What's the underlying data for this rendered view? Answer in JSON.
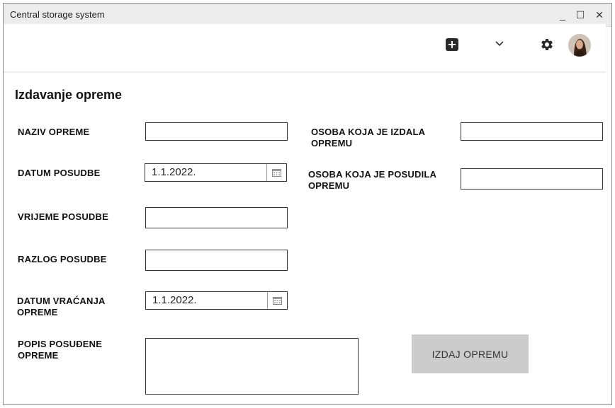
{
  "window": {
    "title": "Central storage system",
    "controls": {
      "minimize": "_",
      "maximize": "☐",
      "close": "✕"
    }
  },
  "topbar": {
    "icons": [
      "plus-square-icon",
      "chevron-down-icon",
      "gear-icon",
      "avatar"
    ]
  },
  "form": {
    "title": "Izdavanje opreme",
    "left": {
      "naziv_opreme": {
        "label": "NAZIV OPREME",
        "value": ""
      },
      "datum_posudbe": {
        "label": "DATUM POSUDBE",
        "value": "1.1.2022."
      },
      "vrijeme_posudbe": {
        "label": "VRIJEME POSUDBE",
        "value": ""
      },
      "razlog_posudbe": {
        "label": "RAZLOG POSUDBE",
        "value": ""
      },
      "datum_vracanja": {
        "label_line1": "DATUM VRAĆANJA",
        "label_line2": "OPREME",
        "value": "1.1.2022."
      },
      "popis": {
        "label_line1": "POPIS POSUĐENE",
        "label_line2": "OPREME",
        "value": ""
      }
    },
    "right": {
      "osoba_izdala": {
        "label_line1": "OSOBA KOJA JE IZDALA",
        "label_line2": "OPREMU",
        "value": ""
      },
      "osoba_posudila": {
        "label_line1": "OSOBA KOJA JE POSUDILA",
        "label_line2": "OPREMU",
        "value": ""
      }
    },
    "submit_label": "IZDAJ OPREMU"
  },
  "colors": {
    "titlebar_bg": "#ececec",
    "button_bg": "#cccccc",
    "border": "#333333"
  }
}
